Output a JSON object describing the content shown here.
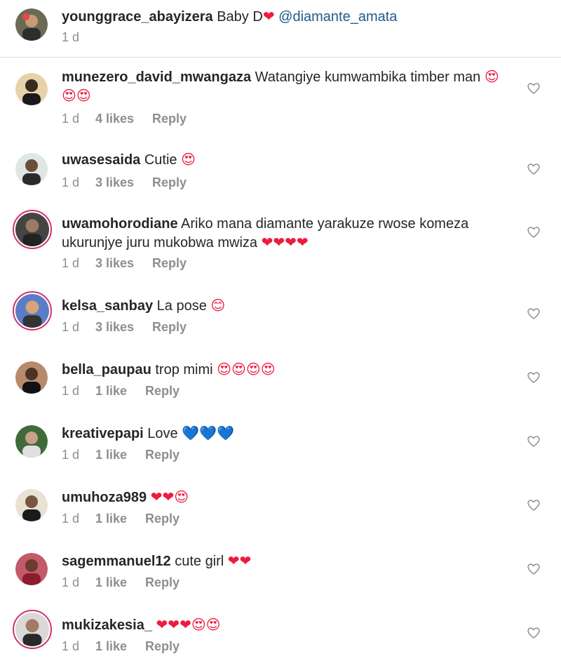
{
  "caption": {
    "username": "younggrace_abayizera",
    "text": "Baby D",
    "emoji": "❤",
    "mention": "@diamante_amata",
    "time": "1 d"
  },
  "colors": {
    "heart": "#ed1c3f",
    "heart_eyes": "#f7b731",
    "blue_heart": "#1da1f2",
    "mention": "#1f5a8a",
    "meta": "#8e8e8e",
    "story_ring": "#d3306e"
  },
  "comments": [
    {
      "username": "munezero_david_mwangaza",
      "text": "Watangiye kumwambika timber man",
      "emojis": "😍😍😍",
      "time": "1 d",
      "likes": "4 likes",
      "reply": "Reply",
      "story_ring": false,
      "like_icon": "heart-outline-icon"
    },
    {
      "username": "uwasesaida",
      "text": "Cutie",
      "emojis": "😍",
      "time": "1 d",
      "likes": "3 likes",
      "reply": "Reply",
      "story_ring": false,
      "like_icon": "heart-outline-icon"
    },
    {
      "username": "uwamohorodiane",
      "text": "Ariko mana diamante yarakuze rwose komeza ukurunjye juru mukobwa mwiza",
      "emojis": "❤❤❤❤",
      "time": "1 d",
      "likes": "3 likes",
      "reply": "Reply",
      "story_ring": true,
      "like_icon": "heart-outline-icon"
    },
    {
      "username": "kelsa_sanbay",
      "text": "La pose",
      "emojis": "😊",
      "time": "1 d",
      "likes": "3 likes",
      "reply": "Reply",
      "story_ring": true,
      "like_icon": "heart-outline-icon"
    },
    {
      "username": "bella_paupau",
      "text": "trop mimi",
      "emojis": "😍😍😍😍",
      "time": "1 d",
      "likes": "1 like",
      "reply": "Reply",
      "story_ring": false,
      "like_icon": "heart-outline-icon"
    },
    {
      "username": "kreativepapi",
      "text": "Love",
      "emojis": "💙💙💙",
      "time": "1 d",
      "likes": "1 like",
      "reply": "Reply",
      "story_ring": false,
      "like_icon": "heart-outline-icon"
    },
    {
      "username": "umuhoza989",
      "text": "",
      "emojis": "❤❤😍",
      "time": "1 d",
      "likes": "1 like",
      "reply": "Reply",
      "story_ring": false,
      "like_icon": "heart-outline-icon"
    },
    {
      "username": "sagemmanuel12",
      "text": "cute girl",
      "emojis": "❤❤",
      "time": "1 d",
      "likes": "1 like",
      "reply": "Reply",
      "story_ring": false,
      "like_icon": "heart-outline-icon"
    },
    {
      "username": "mukizakesia_",
      "text": "",
      "emojis": "❤❤❤😍😍",
      "time": "1 d",
      "likes": "1 like",
      "reply": "Reply",
      "story_ring": true,
      "like_icon": "heart-outline-icon"
    }
  ]
}
